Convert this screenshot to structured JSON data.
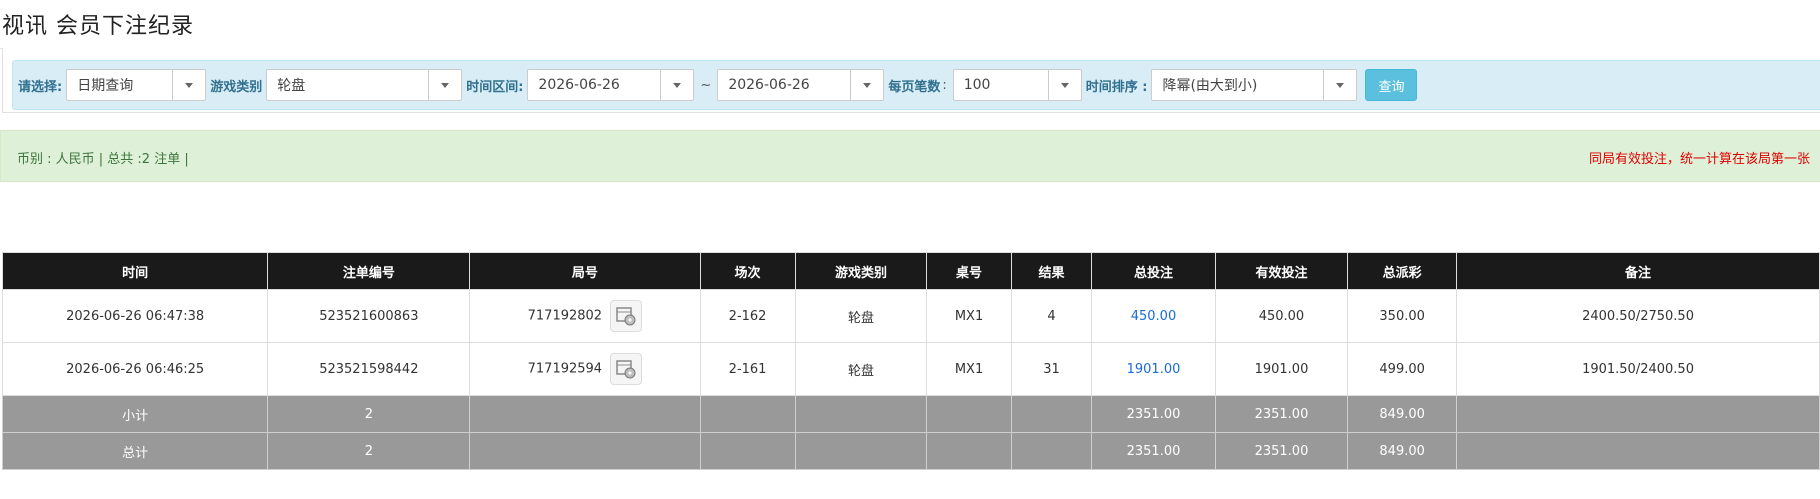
{
  "page": {
    "title": "视讯 会员下注纪录"
  },
  "filters": {
    "select_label": "请选择:",
    "select_value": "日期查询",
    "game_type_label": "游戏类别",
    "game_type_value": "轮盘",
    "time_range_label": "时间区间:",
    "start_date": "2026-06-26",
    "range_sep": "~",
    "end_date": "2026-06-26",
    "page_size_label": "每页笔数",
    "page_size_sep": ":",
    "page_size_value": "100",
    "sort_label": "时间排序 :",
    "sort_value": "降幂(由大到小)",
    "query_label": "查询"
  },
  "summary": {
    "left_text": "币别 : 人民币 | 总共 :2 注单 |",
    "right_text": "同局有效投注，统一计算在该局第一张"
  },
  "table": {
    "headers": [
      "时间",
      "注单编号",
      "局号",
      "场次",
      "游戏类别",
      "桌号",
      "结果",
      "总投注",
      "有效投注",
      "总派彩",
      "备注"
    ],
    "rows": [
      {
        "time": "2026-06-26 06:47:38",
        "order_no": "523521600863",
        "round_no": "717192802",
        "session": "2-162",
        "game_type": "轮盘",
        "table_no": "MX1",
        "result": "4",
        "total_bet": "450.00",
        "valid_bet": "450.00",
        "payout": "350.00",
        "remark": "2400.50/2750.50"
      },
      {
        "time": "2026-06-26 06:46:25",
        "order_no": "523521598442",
        "round_no": "717192594",
        "session": "2-161",
        "game_type": "轮盘",
        "table_no": "MX1",
        "result": "31",
        "total_bet": "1901.00",
        "valid_bet": "1901.00",
        "payout": "499.00",
        "remark": "1901.50/2400.50"
      }
    ],
    "subtotal": {
      "label": "小计",
      "count": "2",
      "total_bet": "2351.00",
      "valid_bet": "2351.00",
      "payout": "849.00"
    },
    "total": {
      "label": "总计",
      "count": "2",
      "total_bet": "2351.00",
      "valid_bet": "2351.00",
      "payout": "849.00"
    }
  },
  "icons": {
    "round_replay": "video-replay-icon",
    "dropdown": "caret-down-icon"
  },
  "colors": {
    "filter_bg": "#d9edf7",
    "summary_bg": "#dff0d8",
    "header_bg": "#1a1a1a",
    "sum_bg": "#999999",
    "link": "#1a6bd6",
    "warning": "#e00000",
    "button": "#5bc0de"
  }
}
